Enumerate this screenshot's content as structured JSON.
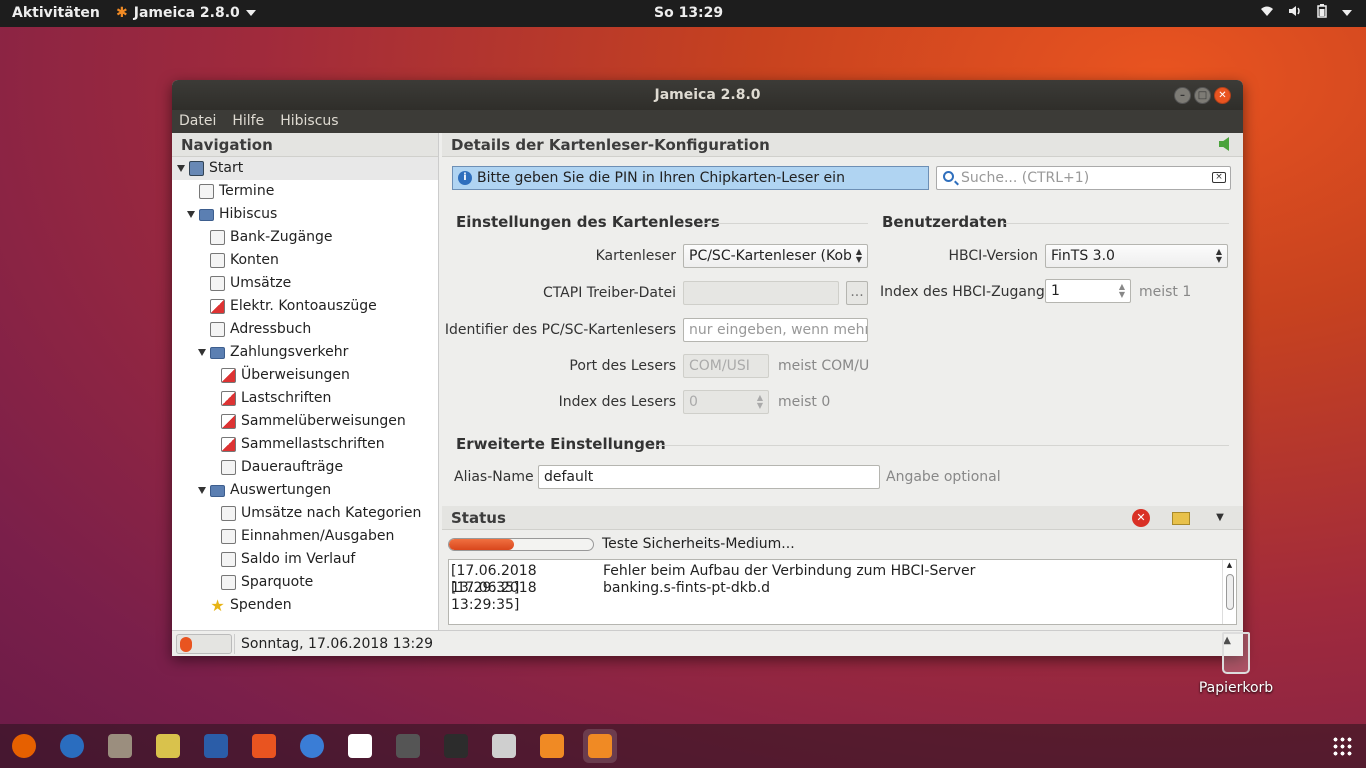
{
  "topbar": {
    "activities": "Aktivitäten",
    "app_name": "Jameica 2.8.0",
    "clock": "So 13:29"
  },
  "window": {
    "title": "Jameica 2.8.0",
    "menu": [
      "Datei",
      "Hilfe",
      "Hibiscus"
    ]
  },
  "navigation": {
    "title": "Navigation",
    "items": [
      {
        "label": "Start",
        "level": 0,
        "expanded": true,
        "icon": "monitor-icon",
        "selected": true
      },
      {
        "label": "Termine",
        "level": 1,
        "icon": "calendar-icon"
      },
      {
        "label": "Hibiscus",
        "level": 1,
        "expanded": true,
        "icon": "folder-icon"
      },
      {
        "label": "Bank-Zugänge",
        "level": 2,
        "icon": "bank-access-icon"
      },
      {
        "label": "Konten",
        "level": 2,
        "icon": "account-icon"
      },
      {
        "label": "Umsätze",
        "level": 2,
        "icon": "transactions-icon"
      },
      {
        "label": "Elektr. Kontoauszüge",
        "level": 2,
        "icon": "pdf-statement-icon"
      },
      {
        "label": "Adressbuch",
        "level": 2,
        "icon": "addressbook-icon"
      },
      {
        "label": "Zahlungsverkehr",
        "level": 2,
        "expanded": true,
        "icon": "folder-icon"
      },
      {
        "label": "Überweisungen",
        "level": 3,
        "icon": "transfer-icon"
      },
      {
        "label": "Lastschriften",
        "level": 3,
        "icon": "debit-icon"
      },
      {
        "label": "Sammelüberweisungen",
        "level": 3,
        "icon": "batch-transfer-icon"
      },
      {
        "label": "Sammellastschriften",
        "level": 3,
        "icon": "batch-debit-icon"
      },
      {
        "label": "Daueraufträge",
        "level": 3,
        "icon": "standing-order-icon"
      },
      {
        "label": "Auswertungen",
        "level": 2,
        "expanded": true,
        "icon": "folder-icon"
      },
      {
        "label": "Umsätze nach Kategorien",
        "level": 3,
        "icon": "category-chart-icon"
      },
      {
        "label": "Einnahmen/Ausgaben",
        "level": 3,
        "icon": "income-expense-icon"
      },
      {
        "label": "Saldo im Verlauf",
        "level": 3,
        "icon": "balance-chart-icon"
      },
      {
        "label": "Sparquote",
        "level": 3,
        "icon": "savings-chart-icon"
      },
      {
        "label": "Spenden",
        "level": 2,
        "icon": "star-icon"
      }
    ]
  },
  "details": {
    "title": "Details der Kartenleser-Konfiguration",
    "info": "Bitte geben Sie die PIN in Ihren Chipkarten-Leser ein",
    "search_placeholder": "Suche...  (CTRL+1)",
    "reader_section": "Einstellungen des Kartenlesers",
    "user_section": "Benutzerdaten",
    "advanced_section": "Erweiterte Einstellungen",
    "fields": {
      "kartenleser_label": "Kartenleser",
      "kartenleser_value": "PC/SC-Kartenleser (Kob",
      "ctapi_label": "CTAPI Treiber-Datei",
      "ctapi_button": "...",
      "identifier_label": "Identifier des PC/SC-Kartenlesers",
      "identifier_placeholder": "nur eingeben, wenn mehrer",
      "port_label": "Port des Lesers",
      "port_value": "COM/USI",
      "port_hint": "meist COM/U",
      "index_label": "Index des Lesers",
      "index_value": "0",
      "index_hint": "meist 0",
      "hbci_version_label": "HBCI-Version",
      "hbci_version_value": "FinTS 3.0",
      "hbci_index_label": "Index des HBCI-Zugangs",
      "hbci_index_value": "1",
      "hbci_index_hint": "meist 1",
      "alias_label": "Alias-Name",
      "alias_value": "default",
      "alias_hint": "Angabe optional"
    }
  },
  "status": {
    "title": "Status",
    "progress_label": "Teste Sicherheits-Medium...",
    "progress_fraction": 0.45,
    "log": [
      {
        "time": "[17.06.2018 13:29:35]",
        "message": "Fehler beim Aufbau der Verbindung zum HBCI-Server"
      },
      {
        "time": "[17.06.2018 13:29:35]",
        "message": "banking.s-fints-pt-dkb.d"
      }
    ]
  },
  "bottombar": {
    "datetime": "Sonntag, 17.06.2018 13:29"
  },
  "desktop": {
    "trash_label": "Papierkorb"
  },
  "dock": {
    "apps": [
      {
        "name": "firefox-icon",
        "color": "#e66000"
      },
      {
        "name": "thunderbird-icon",
        "color": "#2a6dbf"
      },
      {
        "name": "files-icon",
        "color": "#9b8e7e"
      },
      {
        "name": "rhythmbox-icon",
        "color": "#d9c24c"
      },
      {
        "name": "libreoffice-writer-icon",
        "color": "#2b5da8"
      },
      {
        "name": "software-center-icon",
        "color": "#e95420"
      },
      {
        "name": "help-icon",
        "color": "#3a7dd6"
      },
      {
        "name": "amazon-icon",
        "color": "#ffffff"
      },
      {
        "name": "software-updater-icon",
        "color": "#555555"
      },
      {
        "name": "terminal-icon",
        "color": "#2c2c2c"
      },
      {
        "name": "screenshot-icon",
        "color": "#cfcfcf"
      },
      {
        "name": "jameica-icon",
        "color": "#f08a24"
      },
      {
        "name": "jameica-running-icon",
        "color": "#f08a24"
      }
    ]
  }
}
